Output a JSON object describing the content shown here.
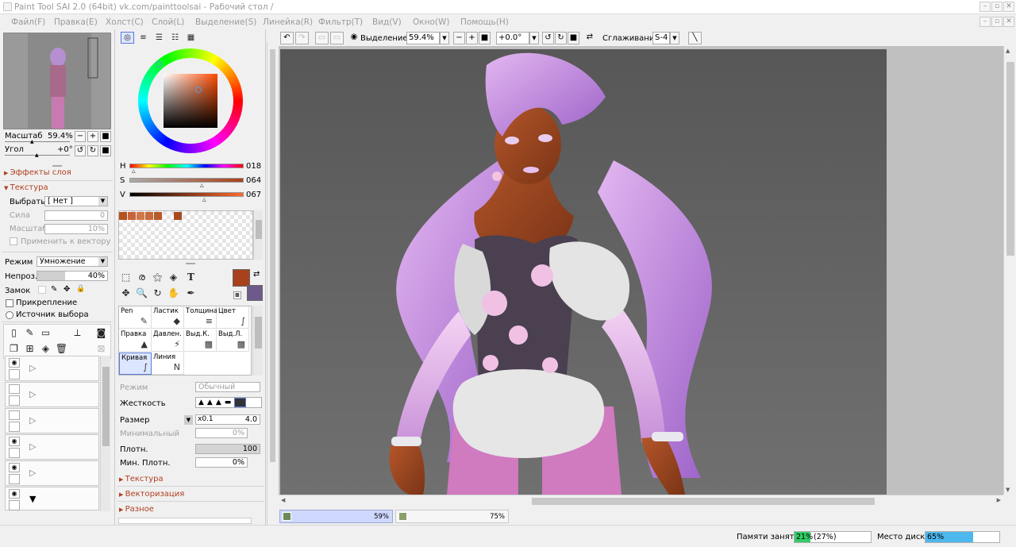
{
  "window": {
    "title": "Paint Tool SAI 2.0 (64bit) vk.com/painttoolsai - Рабочий стол /"
  },
  "menu": [
    "Файл(F)",
    "Правка(E)",
    "Холст(C)",
    "Слой(L)",
    "Выделение(S)",
    "Линейка(R)",
    "Фильтр(T)",
    "Вид(V)",
    "Окно(W)",
    "Помощь(H)"
  ],
  "toolbar": {
    "selection_label": "Выделение",
    "zoom": "59.4%",
    "angle": "+0.0°",
    "smoothing_label": "Сглаживание",
    "smoothing": "S-4"
  },
  "navigator": {
    "scale_label": "Масштаб",
    "scale": "59.4%",
    "angle_label": "Угол",
    "angle": "+0°"
  },
  "layer_panel": {
    "effects": "Эффекты слоя",
    "texture": "Текстура",
    "choose_label": "Выбрать",
    "choose_value": "[ Нет ]",
    "strength_label": "Сила",
    "strength": "0",
    "scale_label": "Масштаб",
    "scale": "10%",
    "apply_vector": "Применить к вектору",
    "mode_label": "Режим",
    "mode": "Умножение",
    "opacity_label": "Непроз.",
    "opacity": "40%",
    "opacity_value": 0.4,
    "lock_label": "Замок",
    "clipping": "Прикрепление",
    "selection_source": "Источник выбора"
  },
  "color": {
    "h_label": "H",
    "h": "018",
    "s_label": "S",
    "s": "064",
    "v_label": "V",
    "v": "067",
    "primary": "#a8421c",
    "secondary": "#6e5a8a",
    "swatches": [
      "#b4521f",
      "#c8643a",
      "#d0784a",
      "#c86a3c",
      "#b85a2c",
      "#a84a20"
    ]
  },
  "tools": {
    "brushes": [
      {
        "label": "Pen",
        "icon": "✎"
      },
      {
        "label": "Ластик",
        "icon": "◆"
      },
      {
        "label": "Толщина",
        "icon": "≡"
      },
      {
        "label": "Цвет",
        "icon": "∫"
      },
      {
        "label": "Правка",
        "icon": "▲"
      },
      {
        "label": "Давлен.",
        "icon": "⚡"
      },
      {
        "label": "Выд.К.",
        "icon": "▩"
      },
      {
        "label": "Выд.Л.",
        "icon": "▩"
      },
      {
        "label": "Кривая",
        "icon": "∫"
      },
      {
        "label": "Линия",
        "icon": "N"
      }
    ]
  },
  "brush_settings": {
    "mode_label": "Режим",
    "mode": "Обычный",
    "hardness_label": "Жесткость",
    "size_label": "Размер",
    "size_mult": "x0.1",
    "size": "4.0",
    "min_label": "Минимальный",
    "min": "0%",
    "density_label": "Плотн.",
    "density": "100",
    "min_density_label": "Мин. Плотн.",
    "min_density": "0%",
    "texture": "Текстура",
    "vectorize": "Векторизация",
    "misc": "Разное"
  },
  "tabs": [
    {
      "label": "59%"
    },
    {
      "label": "75%"
    }
  ],
  "status": {
    "memory_label": "Памяти занято",
    "memory": "21%",
    "memory_paren": "(27%)",
    "memory_value": 0.21,
    "disk_label": "Место диска",
    "disk": "65%",
    "disk_value": 0.65
  }
}
